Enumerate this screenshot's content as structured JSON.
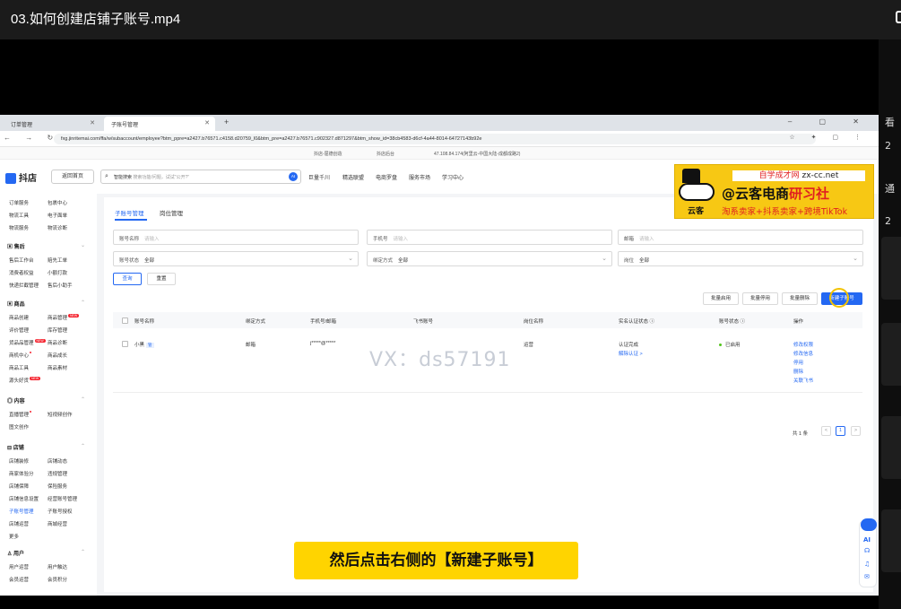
{
  "window": {
    "title": "03.如何创建店铺子账号.mp4"
  },
  "browser": {
    "tabs": [
      {
        "label": "订单管理"
      },
      {
        "label": "子账号管理"
      }
    ],
    "new_tab": "+",
    "url": "fxg.jinritemai.com/ffa/w/subaccount/employee?btm_ppre=a2427.b76571.c4158.d20759_l0&btm_pre=a2427.b76571.c902327.d871297&btm_show_id=38cb4583-d6cf-4a44-8014-64727143b92e",
    "info": {
      "item1": "抖店-屈德创造",
      "item2": "抖店后台",
      "item3": "47.108.84.174(阿里云-中国大陆-成都成路2)"
    }
  },
  "header": {
    "logo": "抖店",
    "home_button": "返回首页",
    "search_prefix": "智能搜索",
    "search_placeholder": "搜索功能/问题，试试\"公开?\"",
    "search_ai": "AI",
    "nav": [
      "巨量千川",
      "精选联盟",
      "电商罗盘",
      "服务市场",
      "学习中心"
    ]
  },
  "sidebar": {
    "rows_top": [
      [
        "订单服务",
        "包裹中心"
      ],
      [
        "物流工具",
        "电子面单"
      ],
      [
        "物流服务",
        "物流诊断"
      ]
    ],
    "section_aftersale": "售后",
    "rows_aftersale": [
      [
        "售后工作台",
        "赔先工单"
      ],
      [
        "消费者权益",
        "小额打款"
      ],
      [
        "快递拦截管理",
        "售后小助手"
      ]
    ],
    "section_goods": "商品",
    "rows_goods": [
      [
        "商品创建",
        "商品管理"
      ],
      [
        "评价管理",
        "库存管理"
      ],
      [
        "货品品管理",
        "商品诊断"
      ],
      [
        "商机中心",
        "商品成长"
      ],
      [
        "商品工具",
        "商品素材"
      ],
      [
        "源头好货",
        ""
      ]
    ],
    "new_badge": "NEW",
    "section_content": "内容",
    "rows_content": [
      [
        "直播管理",
        "短视频创作"
      ],
      [
        "图文创作",
        ""
      ]
    ],
    "section_shop": "店铺",
    "rows_shop": [
      [
        "店铺装修",
        "店铺动态"
      ],
      [
        "商家体验分",
        "违规管理"
      ],
      [
        "店铺保障",
        "保险服务"
      ],
      [
        "店铺信息设置",
        "经营账号管理"
      ],
      [
        "子账号管理",
        "子账号授权"
      ],
      [
        "店铺运营",
        "商城经营"
      ],
      [
        "更多",
        ""
      ]
    ],
    "section_user": "用户",
    "rows_user": [
      [
        "用户运营",
        "用户触达"
      ],
      [
        "会员运营",
        "会员积分"
      ]
    ]
  },
  "content": {
    "tabs": [
      "子账号管理",
      "岗位管理"
    ],
    "filters": {
      "account_name_label": "账号名称",
      "account_name_ph": "请输入",
      "phone_label": "手机号",
      "phone_ph": "请输入",
      "email_label": "邮箱",
      "email_ph": "请输入",
      "status_label": "账号状态",
      "status_val": "全部",
      "bind_label": "绑定方式",
      "bind_val": "全部",
      "role_label": "岗位",
      "role_val": "全部"
    },
    "query_button": "查询",
    "reset_button": "重置",
    "batch_enable": "批量启用",
    "batch_disable": "批量停用",
    "batch_delete": "批量删除",
    "new_subaccount": "新建子账号",
    "table": {
      "headers": [
        "账号名称",
        "绑定方式",
        "手机号/邮箱",
        "飞书账号",
        "岗位名称",
        "实名认证状态 ⓘ",
        "账号状态 ⓘ",
        "操作"
      ],
      "row": {
        "name": "小黑",
        "tag": "管",
        "bind": "邮箱",
        "phone": "j*****@*****",
        "feishu": "",
        "role": "运营",
        "auth_status": "认证完成",
        "auth_action": "解除认证 >",
        "status": "已启用",
        "actions": [
          "修改权限",
          "修改信息",
          "停用",
          "删除",
          "关联飞书"
        ]
      }
    },
    "pagination": {
      "total": "共 1 条",
      "prev": "<",
      "page": "1",
      "next": ">"
    }
  },
  "watermark": "VX：ds57191",
  "ad": {
    "line1_a": "自学成才网",
    "line1_b": "zx-cc.net",
    "line2_a": "@云客电商",
    "line2_b": "研习社",
    "line3": "淘系卖家+抖系卖家+跨境TikTok",
    "brand": "云客"
  },
  "subtitle": "然后点击右侧的【新建子账号】",
  "float_tools": {
    "ai": "AI"
  },
  "right_strip": {
    "chars": [
      "看",
      "2",
      "通",
      "2"
    ]
  },
  "colors": {
    "accent": "#2468f2",
    "subtitle_bg": "#ffd400",
    "ad_bg": "#f7c814"
  }
}
